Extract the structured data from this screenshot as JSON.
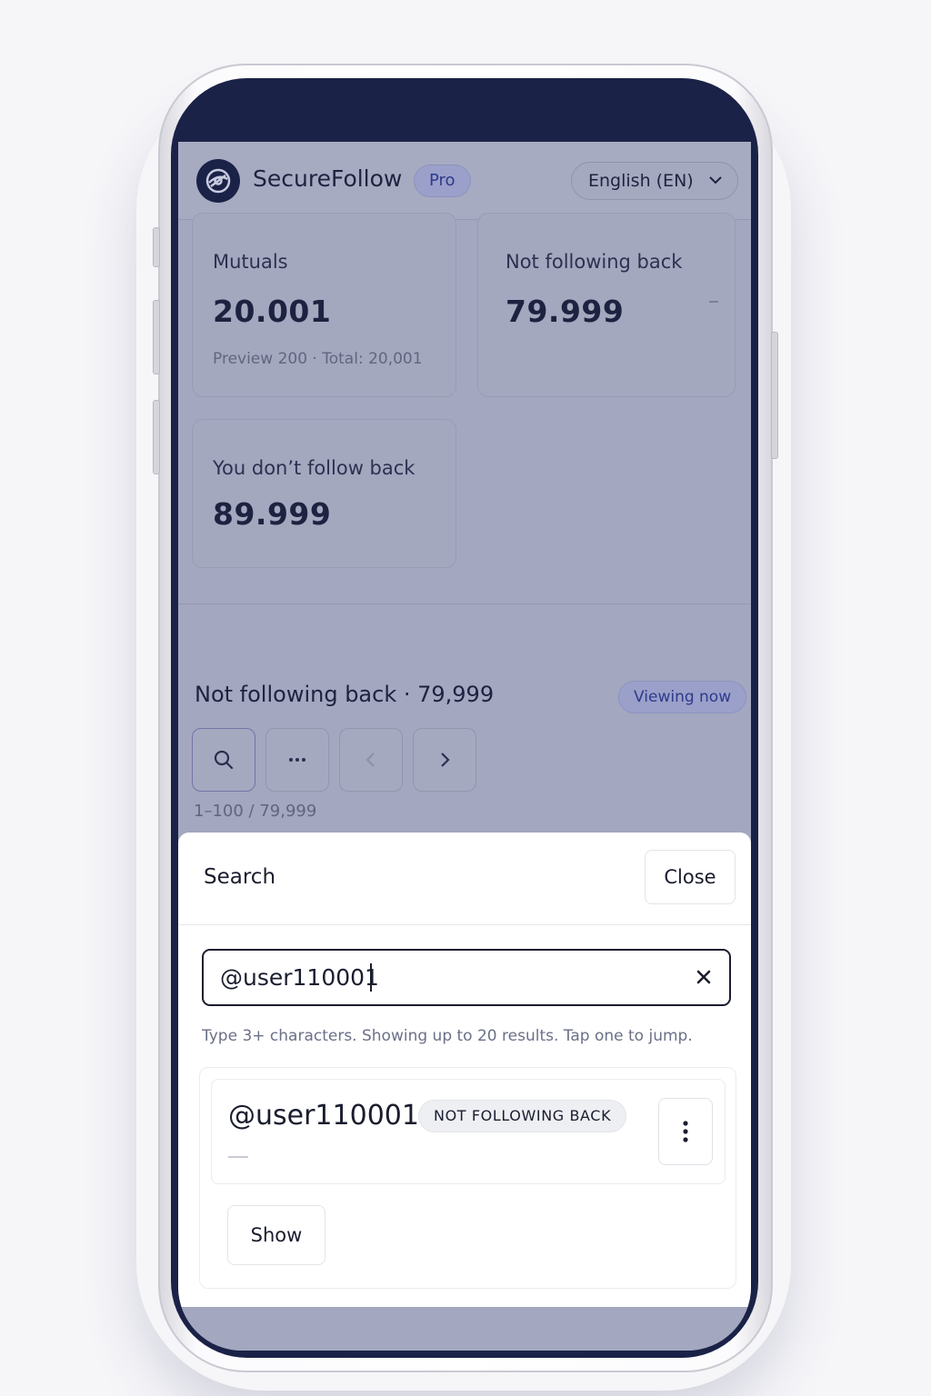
{
  "header": {
    "brand": "SecureFollow",
    "plan_badge": "Pro",
    "language": "English (EN)"
  },
  "stats": {
    "mutuals": {
      "label": "Mutuals",
      "value": "20.001",
      "sub": "Preview 200 · Total: 20,001"
    },
    "not_following_back": {
      "label": "Not following back",
      "value": "79.999"
    },
    "you_dont_follow_back": {
      "label": "You don’t follow back",
      "value": "89.999"
    }
  },
  "list": {
    "title": "Not following back · 79,999",
    "badge": "Viewing now",
    "range": "1–100 / 79,999"
  },
  "search_sheet": {
    "title": "Search",
    "close_label": "Close",
    "query": "@user110001",
    "hint": "Type 3+ characters. Showing up to 20 results. Tap one to jump.",
    "results": [
      {
        "handle": "@user110001",
        "status": "NOT FOLLOWING BACK"
      }
    ],
    "show_label": "Show"
  }
}
